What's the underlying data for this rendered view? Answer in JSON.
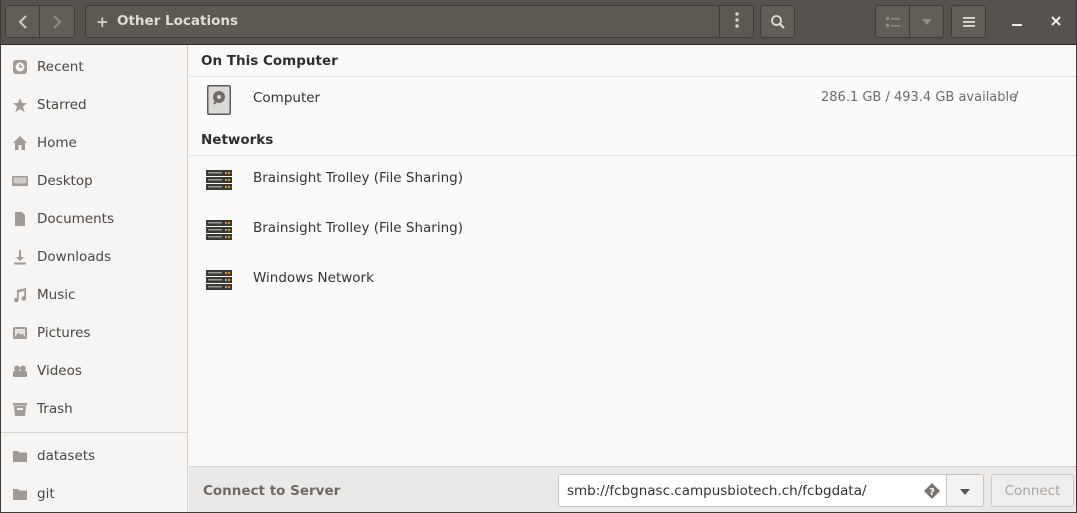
{
  "header": {
    "location_label": "Other Locations",
    "plus_glyph": "+",
    "icons": [
      "go-back-icon",
      "go-forward-icon",
      "path-menu-icon",
      "search-icon",
      "list-view-icon",
      "view-options-icon",
      "app-menu-icon",
      "minimize-icon",
      "close-icon"
    ]
  },
  "sidebar": {
    "items": [
      {
        "label": "Recent",
        "icon": "clock-icon"
      },
      {
        "label": "Starred",
        "icon": "star-icon"
      },
      {
        "label": "Home",
        "icon": "home-icon"
      },
      {
        "label": "Desktop",
        "icon": "desktop-icon"
      },
      {
        "label": "Documents",
        "icon": "document-icon"
      },
      {
        "label": "Downloads",
        "icon": "download-icon"
      },
      {
        "label": "Music",
        "icon": "music-icon"
      },
      {
        "label": "Pictures",
        "icon": "picture-icon"
      },
      {
        "label": "Videos",
        "icon": "video-icon"
      },
      {
        "label": "Trash",
        "icon": "trash-icon"
      }
    ],
    "bookmarks": [
      {
        "label": "datasets",
        "icon": "folder-icon"
      },
      {
        "label": "git",
        "icon": "folder-icon"
      }
    ]
  },
  "main": {
    "on_this_computer": {
      "title": "On This Computer",
      "items": [
        {
          "name": "Computer",
          "space": "286.1 GB / 493.4 GB available",
          "path": "/",
          "icon": "drive-icon"
        }
      ]
    },
    "networks": {
      "title": "Networks",
      "items": [
        {
          "name": "Brainsight Trolley (File Sharing)",
          "icon": "network-server-icon"
        },
        {
          "name": "Brainsight Trolley (File Sharing)",
          "icon": "network-server-icon"
        },
        {
          "name": "Windows Network",
          "icon": "network-server-icon"
        }
      ]
    }
  },
  "connect": {
    "label": "Connect to Server",
    "server_address": "smb://fcbgnasc.campusbiotech.ch/fcbgdata/",
    "button_label": "Connect"
  },
  "colors": {
    "headerbar": "#57524d",
    "sidebar_bg": "#f6f5f4",
    "content_bg": "#fafafa"
  }
}
